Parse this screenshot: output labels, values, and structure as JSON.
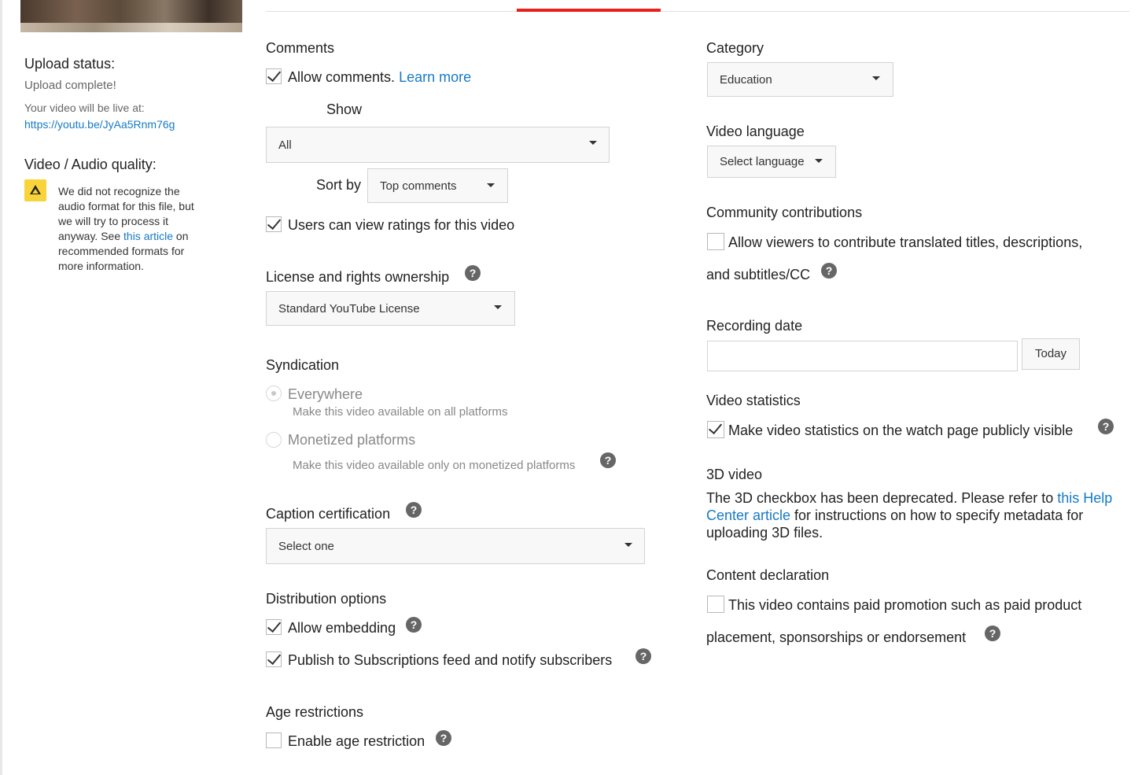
{
  "left": {
    "upload_status_label": "Upload status:",
    "upload_complete": "Upload complete!",
    "live_at": "Your video will be live at:",
    "video_url": "https://youtu.be/JyAa5Rnm76g",
    "quality_label": "Video / Audio quality:",
    "warning_line1": "We did not recognize the",
    "warning_line2": "audio format for this file, but",
    "warning_line3": "we will try to process it",
    "warning_line4_pre": "anyway. See ",
    "warning_link": "this article",
    "warning_line4_post": " on",
    "warning_line5": "recommended formats for",
    "warning_line6": "more information."
  },
  "comments": {
    "heading": "Comments",
    "allow_label": "Allow comments.",
    "learn_more": "Learn more",
    "allow_checked": true,
    "show_label": "Show",
    "show_value": "All",
    "sort_label": "Sort by",
    "sort_value": "Top comments",
    "ratings_label": "Users can view ratings for this video",
    "ratings_checked": true
  },
  "license": {
    "heading": "License and rights ownership",
    "value": "Standard YouTube License"
  },
  "syndication": {
    "heading": "Syndication",
    "everywhere_label": "Everywhere",
    "everywhere_desc": "Make this video available on all platforms",
    "everywhere_selected": true,
    "monetized_label": "Monetized platforms",
    "monetized_desc": "Make this video available only on monetized platforms"
  },
  "caption": {
    "heading": "Caption certification",
    "value": "Select one"
  },
  "distribution": {
    "heading": "Distribution options",
    "embedding_label": "Allow embedding",
    "embedding_checked": true,
    "publish_label": "Publish to Subscriptions feed and notify subscribers",
    "publish_checked": true
  },
  "age": {
    "heading": "Age restrictions",
    "label": "Enable age restriction",
    "checked": false
  },
  "category": {
    "heading": "Category",
    "value": "Education"
  },
  "language": {
    "heading": "Video language",
    "value": "Select language"
  },
  "community": {
    "heading": "Community contributions",
    "line1": "Allow viewers to contribute translated titles, descriptions,",
    "line2": "and subtitles/CC",
    "checked": false
  },
  "recording": {
    "heading": "Recording date",
    "value": "",
    "today_label": "Today"
  },
  "stats": {
    "heading": "Video statistics",
    "label": "Make video statistics on the watch page publicly visible",
    "checked": true
  },
  "video3d": {
    "heading": "3D video",
    "line1_pre": "The 3D checkbox has been deprecated. Please refer to ",
    "line1_link": "this Help",
    "line2_link": "Center article",
    "line2_post": " for instructions on how to specify metadata for",
    "line3": "uploading 3D files."
  },
  "content": {
    "heading": "Content declaration",
    "line1": "This video contains paid promotion such as paid product",
    "line2": "placement, sponsorships or endorsement",
    "checked": false
  },
  "help_glyph": "?",
  "colors": {
    "accent_red": "#e62117",
    "link_blue": "#167ac6",
    "warning_yellow": "#f8d43a"
  }
}
